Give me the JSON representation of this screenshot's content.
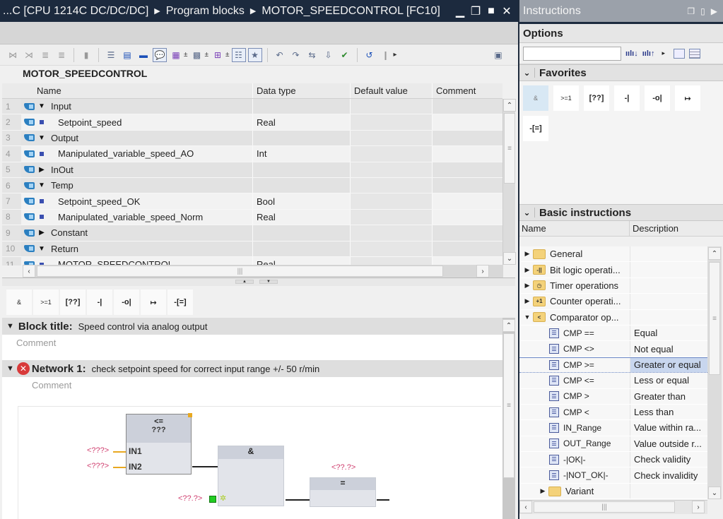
{
  "editor": {
    "breadcrumb": [
      "...C [CPU 1214C DC/DC/DC]",
      "Program blocks",
      "MOTOR_SPEEDCONTROL [FC10]"
    ],
    "window_controls": [
      "minimize",
      "restore",
      "maximize",
      "close"
    ],
    "block_name": "MOTOR_SPEEDCONTROL",
    "toolbar_icons": [
      "insert-row-icon",
      "delete-row-icon",
      "insert-network-icon",
      "delete-network-icon",
      "reset-start-values-icon",
      "abs-symbolic-icon",
      "open-all-networks-icon",
      "close-all-networks-icon",
      "network-comments-icon",
      "favorites-icon",
      "insert-tag-icon",
      "rename-tag-icon",
      "insert-call-icon",
      "show-hide-icon",
      "navigation-icon",
      "go-to-error-prev-icon",
      "go-to-error-next-icon",
      "compare-icon",
      "download-icon",
      "callstack-icon",
      "monitoring-icon",
      "compile-icon"
    ],
    "interface": {
      "columns": [
        "Name",
        "Data type",
        "Default value",
        "Comment"
      ],
      "rows": [
        {
          "num": "1",
          "kind": "group",
          "expanded": true,
          "name": "Input",
          "type": ""
        },
        {
          "num": "2",
          "kind": "item",
          "name": "Setpoint_speed",
          "type": "Real"
        },
        {
          "num": "3",
          "kind": "group",
          "expanded": true,
          "name": "Output",
          "type": ""
        },
        {
          "num": "4",
          "kind": "item",
          "name": "Manipulated_variable_speed_AO",
          "type": "Int"
        },
        {
          "num": "5",
          "kind": "group",
          "expanded": false,
          "name": "InOut",
          "type": ""
        },
        {
          "num": "6",
          "kind": "group",
          "expanded": true,
          "name": "Temp",
          "type": ""
        },
        {
          "num": "7",
          "kind": "item",
          "name": "Setpoint_speed_OK",
          "type": "Bool"
        },
        {
          "num": "8",
          "kind": "item",
          "name": "Manipulated_variable_speed_Norm",
          "type": "Real"
        },
        {
          "num": "9",
          "kind": "group",
          "expanded": false,
          "name": "Constant",
          "type": ""
        },
        {
          "num": "10",
          "kind": "group",
          "expanded": true,
          "name": "Return",
          "type": ""
        },
        {
          "num": "11",
          "kind": "item",
          "name": "MOTOR_SPEEDCONTROL",
          "type": "Real"
        }
      ]
    },
    "lad_favorites": [
      "&",
      ">=1",
      "[??]",
      "-|",
      "-o|",
      "↦",
      "-[=]"
    ],
    "block_title": {
      "label": "Block title:",
      "text": "Speed control via analog output",
      "comment": "Comment"
    },
    "network1": {
      "label": "Network 1:",
      "text": "check setpoint speed for correct input range +/- 50 r/min",
      "comment": "Comment",
      "has_error": true,
      "cmp_box": {
        "op": "<=",
        "type": "???",
        "pins": [
          "IN1",
          "IN2"
        ],
        "in1": "<???>",
        "in2": "<???>"
      },
      "and_box": {
        "op": "&",
        "in": "<??.?>"
      },
      "assign_box": {
        "op": "=",
        "operand": "<??.?>"
      }
    }
  },
  "instructions": {
    "title": "Instructions",
    "options_label": "Options",
    "search_value": "",
    "favorites": {
      "label": "Favorites",
      "items": [
        "&",
        ">=1",
        "[??]",
        "-|",
        "-o|",
        "↦",
        "-[=]"
      ]
    },
    "basic": {
      "label": "Basic instructions",
      "columns": [
        "Name",
        "Description"
      ],
      "rows": [
        {
          "kind": "folder",
          "expanded": false,
          "name": "General",
          "desc": "",
          "glyph": ""
        },
        {
          "kind": "folder",
          "expanded": false,
          "name": "Bit logic operati...",
          "desc": "",
          "glyph": "-||"
        },
        {
          "kind": "folder",
          "expanded": false,
          "name": "Timer operations",
          "desc": "",
          "glyph": "◷"
        },
        {
          "kind": "folder",
          "expanded": false,
          "name": "Counter operati...",
          "desc": "",
          "glyph": "+1"
        },
        {
          "kind": "folder",
          "expanded": true,
          "name": "Comparator op...",
          "desc": "",
          "glyph": "<"
        },
        {
          "kind": "inst",
          "name": "CMP ==",
          "desc": "Equal"
        },
        {
          "kind": "inst",
          "name": "CMP <>",
          "desc": "Not equal"
        },
        {
          "kind": "inst",
          "name": "CMP >=",
          "desc": "Greater or equal",
          "selected": true
        },
        {
          "kind": "inst",
          "name": "CMP <=",
          "desc": "Less or equal"
        },
        {
          "kind": "inst",
          "name": "CMP >",
          "desc": "Greater than"
        },
        {
          "kind": "inst",
          "name": "CMP <",
          "desc": "Less than"
        },
        {
          "kind": "inst",
          "name": "IN_Range",
          "desc": "Value within ra..."
        },
        {
          "kind": "inst",
          "name": "OUT_Range",
          "desc": "Value outside r..."
        },
        {
          "kind": "inst",
          "name": "-|OK|-",
          "desc": "Check validity"
        },
        {
          "kind": "inst",
          "name": "-|NOT_OK|-",
          "desc": "Check invalidity"
        },
        {
          "kind": "folder",
          "expanded": false,
          "name": "Variant",
          "desc": "",
          "glyph": "",
          "indent": true
        }
      ]
    }
  }
}
